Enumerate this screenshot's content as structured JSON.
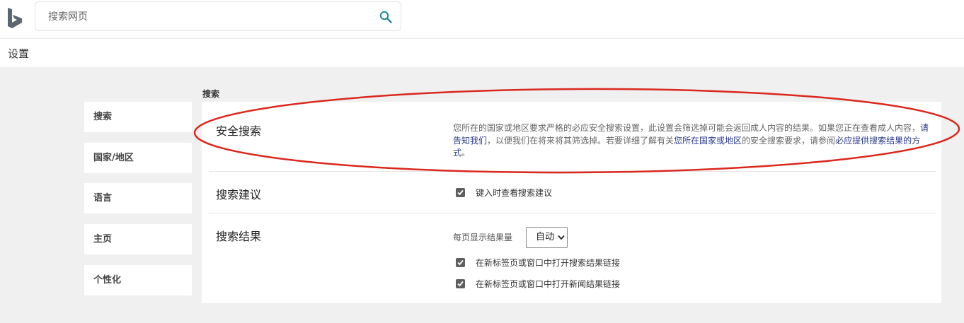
{
  "search": {
    "placeholder": "搜索网页"
  },
  "page": {
    "title": "设置"
  },
  "sidebar": {
    "items": [
      {
        "label": "搜索"
      },
      {
        "label": "国家/地区"
      },
      {
        "label": "语言"
      },
      {
        "label": "主页"
      },
      {
        "label": "个性化"
      }
    ]
  },
  "main": {
    "section_title": "搜索",
    "safe_search": {
      "title": "安全搜索",
      "desc_part1": "您所在的国家或地区要求严格的必应安全搜索设置，此设置会筛选掉可能会返回成人内容的结果。如果您正在查看成人内容，",
      "link1": "请告知我们",
      "desc_part2": "，以便我们在将来将其筛选掉。若要详细了解有关",
      "link2": "您所在国家或地区",
      "desc_part3": "的安全搜索要求，请参阅",
      "link3": "必应提供搜索结果的方式",
      "desc_part4": "。"
    },
    "suggestions": {
      "title": "搜索建议",
      "checkbox_label": "键入时查看搜索建议",
      "checked": true
    },
    "results": {
      "title": "搜索结果",
      "per_page_label": "每页显示结果量",
      "per_page_value": "自动",
      "open_results_label": "在新标签页或窗口中打开搜索结果链接",
      "open_results_checked": true,
      "open_news_label": "在新标签页或窗口中打开新闻结果链接",
      "open_news_checked": true
    }
  },
  "colors": {
    "accent_search_icon": "#1d8a99",
    "annotation_ellipse": "#d9281e",
    "link": "#2a3a86"
  }
}
